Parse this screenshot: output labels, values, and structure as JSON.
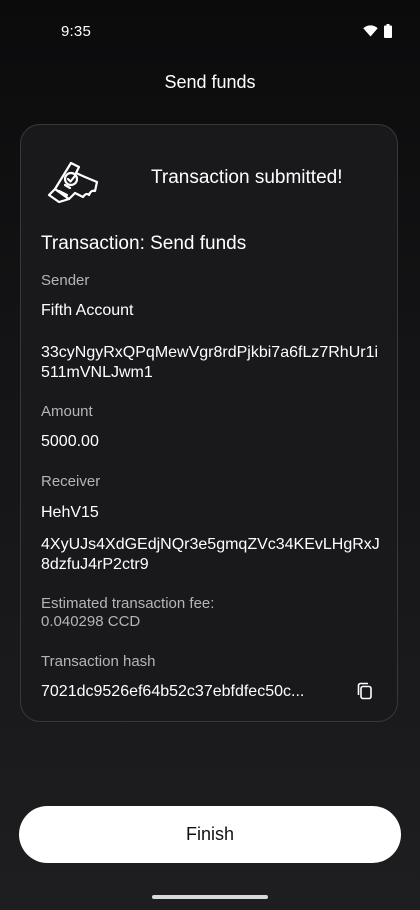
{
  "status_bar": {
    "time": "9:35",
    "icons": [
      "wifi-icon",
      "battery-icon"
    ]
  },
  "page": {
    "title": "Send funds"
  },
  "card": {
    "header_text": "Transaction submitted!",
    "header_icon": "receipt-icon",
    "tx_title": "Transaction: Send funds",
    "sender_label": "Sender",
    "sender_name": "Fifth Account",
    "sender_address": "33cyNgyRxQPqMewVgr8rdPjkbi7a6fLz7RhUr1i511mVNLJwm1",
    "amount_label": "Amount",
    "amount_value": "5000.00",
    "receiver_label": "Receiver",
    "receiver_name": "HehV15",
    "receiver_address": "4XyUJs4XdGEdjNQr3e5gmqZVc34KEvLHgRxJ8dzfuJ4rP2ctr9",
    "fee_label": "Estimated transaction fee:",
    "fee_value": "0.040298 CCD",
    "hash_label": "Transaction hash",
    "hash_value": "7021dc9526ef64b52c37ebfdfec50c..."
  },
  "actions": {
    "finish_label": "Finish"
  }
}
